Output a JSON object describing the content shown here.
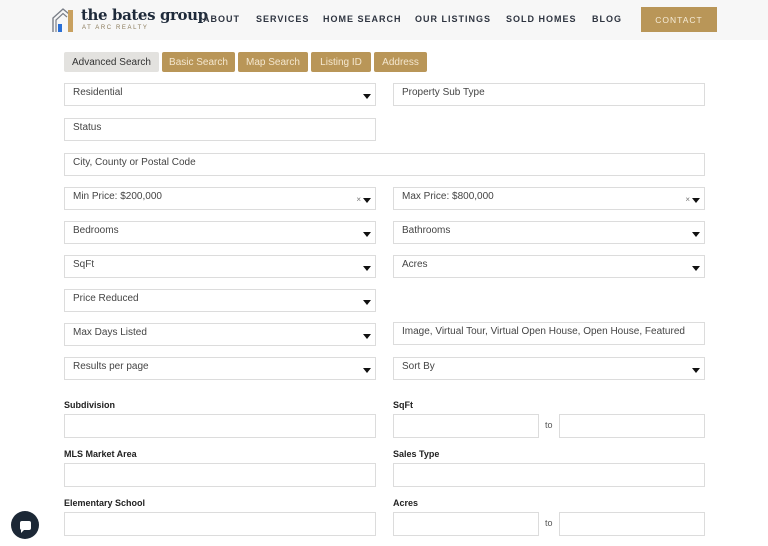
{
  "brand": {
    "title": "the bates group",
    "subtitle": "AT ARC REALTY",
    "colors": {
      "gold": "#b99658",
      "navy": "#1e2a3a",
      "blue": "#2a6fd6"
    }
  },
  "nav": {
    "items": [
      {
        "label": "ABOUT"
      },
      {
        "label": "SERVICES"
      },
      {
        "label": "HOME SEARCH"
      },
      {
        "label": "OUR LISTINGS"
      },
      {
        "label": "SOLD HOMES"
      },
      {
        "label": "BLOG"
      }
    ],
    "contact_label": "CONTACT"
  },
  "search_tabs": [
    {
      "label": "Advanced Search",
      "active": true
    },
    {
      "label": "Basic Search",
      "active": false
    },
    {
      "label": "Map Search",
      "active": false
    },
    {
      "label": "Listing ID",
      "active": false
    },
    {
      "label": "Address",
      "active": false
    }
  ],
  "filters": {
    "property_type": {
      "value": "Residential"
    },
    "property_sub_type": {
      "placeholder": "Property Sub Type"
    },
    "status": {
      "placeholder": "Status"
    },
    "location": {
      "placeholder": "City, County or Postal Code"
    },
    "min_price": {
      "value": "Min Price: $200,000",
      "clear": "×"
    },
    "max_price": {
      "value": "Max Price: $800,000",
      "clear": "×"
    },
    "bedrooms": {
      "placeholder": "Bedrooms"
    },
    "bathrooms": {
      "placeholder": "Bathrooms"
    },
    "sqft": {
      "placeholder": "SqFt"
    },
    "acres": {
      "placeholder": "Acres"
    },
    "price_reduced": {
      "placeholder": "Price Reduced"
    },
    "max_days_listed": {
      "placeholder": "Max Days Listed"
    },
    "features": {
      "value": "Image, Virtual Tour, Virtual Open House, Open House, Featured"
    },
    "results_per_page": {
      "placeholder": "Results per page"
    },
    "sort_by": {
      "placeholder": "Sort By"
    }
  },
  "extra_fields": {
    "subdivision": {
      "label": "Subdivision",
      "value": ""
    },
    "sqft_range": {
      "label": "SqFt",
      "from": "",
      "to": "",
      "separator": "to"
    },
    "mls_market_area": {
      "label": "MLS Market Area",
      "value": ""
    },
    "sales_type": {
      "label": "Sales Type",
      "value": ""
    },
    "elementary_school": {
      "label": "Elementary School",
      "value": ""
    },
    "acres_range": {
      "label": "Acres",
      "from": "",
      "to": "",
      "separator": "to"
    }
  }
}
